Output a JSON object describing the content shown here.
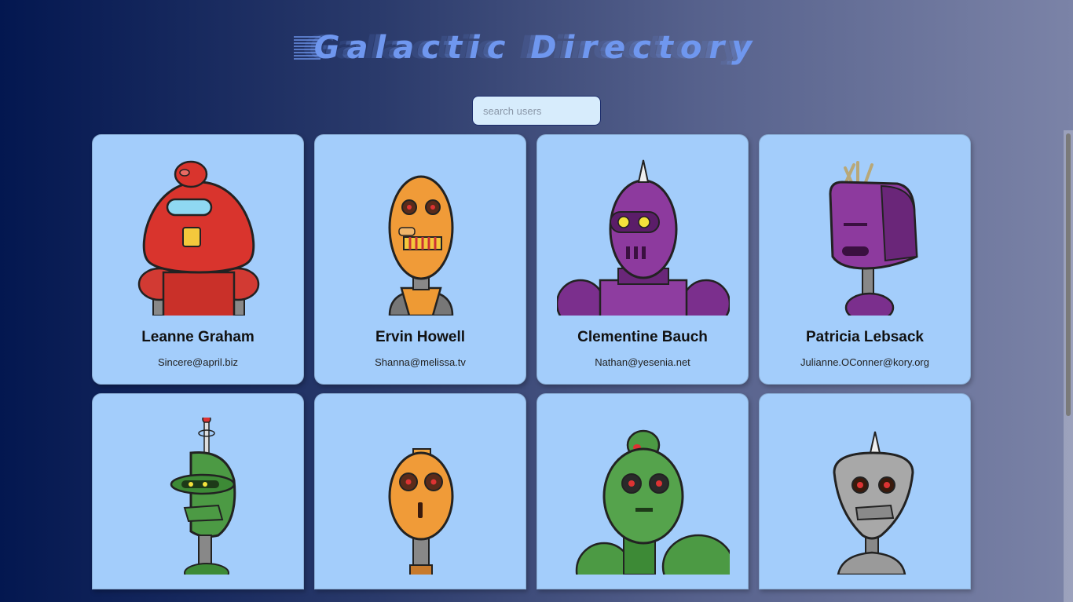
{
  "app": {
    "title": "Galactic Directory"
  },
  "search": {
    "placeholder": "search users",
    "value": ""
  },
  "users": [
    {
      "name": "Leanne Graham",
      "email": "Sincere@april.biz",
      "avatar": "red-robot-icon"
    },
    {
      "name": "Ervin Howell",
      "email": "Shanna@melissa.tv",
      "avatar": "orange-robot-icon"
    },
    {
      "name": "Clementine Bauch",
      "email": "Nathan@yesenia.net",
      "avatar": "purple-robot-icon"
    },
    {
      "name": "Patricia Lebsack",
      "email": "Julianne.OConner@kory.org",
      "avatar": "purple-box-robot-icon"
    },
    {
      "name": "",
      "email": "",
      "avatar": "green-antenna-robot-icon"
    },
    {
      "name": "",
      "email": "",
      "avatar": "orange-round-robot-icon"
    },
    {
      "name": "",
      "email": "",
      "avatar": "green-robot-icon"
    },
    {
      "name": "",
      "email": "",
      "avatar": "silver-robot-icon"
    }
  ],
  "colors": {
    "background_start": "#031750",
    "background_end": "#7b83a7",
    "card": "#a3cdfb",
    "title": "#6f97ef",
    "search_bg": "#d7ecfc"
  }
}
